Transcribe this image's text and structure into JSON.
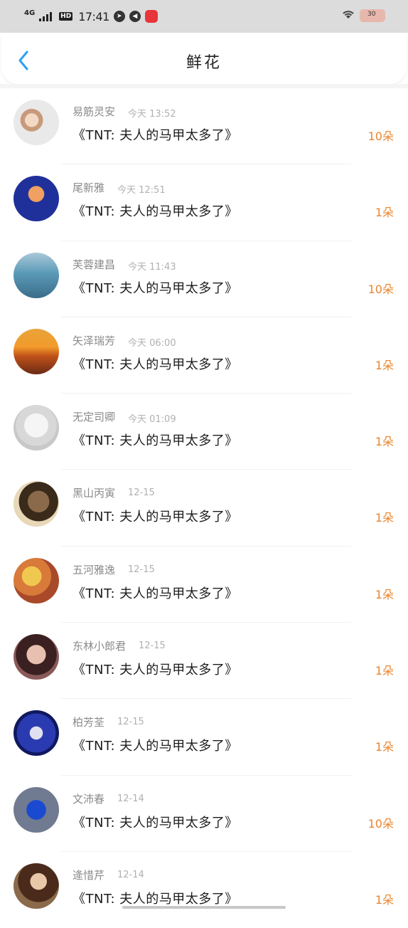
{
  "status_bar": {
    "network": "4G",
    "hd_badge": "HD",
    "time": "17:41",
    "battery": "30",
    "accent": "#dcdcdc"
  },
  "header": {
    "title": "鲜花",
    "back_icon": "chevron-left-icon",
    "accent_color": "#2a9ff6"
  },
  "colors": {
    "count": "#e8852f",
    "name": "#8a8a8a",
    "book": "#1c1c1c"
  },
  "list": {
    "items": [
      {
        "name": "易筋灵安",
        "time": "今天 13:52",
        "book": "《TNT: 夫人的马甲太多了》",
        "count": "10朵",
        "avatar": "a1"
      },
      {
        "name": "尾新雅",
        "time": "今天 12:51",
        "book": "《TNT: 夫人的马甲太多了》",
        "count": "1朵",
        "avatar": "a2"
      },
      {
        "name": "芙蓉建昌",
        "time": "今天 11:43",
        "book": "《TNT: 夫人的马甲太多了》",
        "count": "10朵",
        "avatar": "a3"
      },
      {
        "name": "矢泽瑞芳",
        "time": "今天 06:00",
        "book": "《TNT: 夫人的马甲太多了》",
        "count": "1朵",
        "avatar": "a4"
      },
      {
        "name": "无定司卿",
        "time": "今天 01:09",
        "book": "《TNT: 夫人的马甲太多了》",
        "count": "1朵",
        "avatar": "a5"
      },
      {
        "name": "黑山丙寅",
        "time": "12-15",
        "book": "《TNT: 夫人的马甲太多了》",
        "count": "1朵",
        "avatar": "a6"
      },
      {
        "name": "五河雅逸",
        "time": "12-15",
        "book": "《TNT: 夫人的马甲太多了》",
        "count": "1朵",
        "avatar": "a7"
      },
      {
        "name": "东林小郎君",
        "time": "12-15",
        "book": "《TNT: 夫人的马甲太多了》",
        "count": "1朵",
        "avatar": "a8"
      },
      {
        "name": "柏芳荃",
        "time": "12-15",
        "book": "《TNT: 夫人的马甲太多了》",
        "count": "1朵",
        "avatar": "a9"
      },
      {
        "name": "文沛春",
        "time": "12-14",
        "book": "《TNT: 夫人的马甲太多了》",
        "count": "10朵",
        "avatar": "a10"
      },
      {
        "name": "逄惜芹",
        "time": "12-14",
        "book": "《TNT: 夫人的马甲太多了》",
        "count": "1朵",
        "avatar": "a11"
      }
    ]
  }
}
